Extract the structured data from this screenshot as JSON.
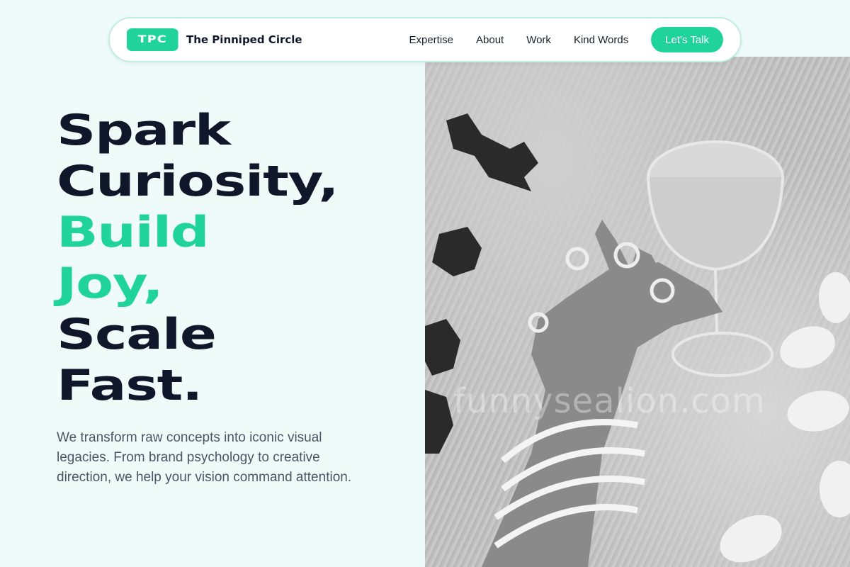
{
  "header": {
    "logo_text": "TPC",
    "brand_name": "The Pinniped Circle",
    "nav": [
      {
        "label": "Expertise"
      },
      {
        "label": "About"
      },
      {
        "label": "Work"
      },
      {
        "label": "Kind Words"
      }
    ],
    "cta_label": "Let's Talk"
  },
  "hero": {
    "heading_lines": [
      {
        "text": "Spark"
      },
      {
        "text": "Curiosity,"
      },
      {
        "text": "Build"
      },
      {
        "text": "Joy,"
      },
      {
        "text": "Scale"
      },
      {
        "text": "Fast."
      }
    ],
    "subtext": "We transform raw concepts into iconic visual legacies. From brand psychology to creative direction, we help your vision command attention.",
    "image": {
      "description": "hand-with-chain-bracelets-holding-coupe-glass",
      "watermark": "funnysealion.com"
    }
  },
  "colors": {
    "accent": "#1fd39b",
    "heading": "#10172a",
    "background": "#effbf8",
    "body_text": "#4a5567"
  },
  "icons": [
    "tpc-logo"
  ]
}
